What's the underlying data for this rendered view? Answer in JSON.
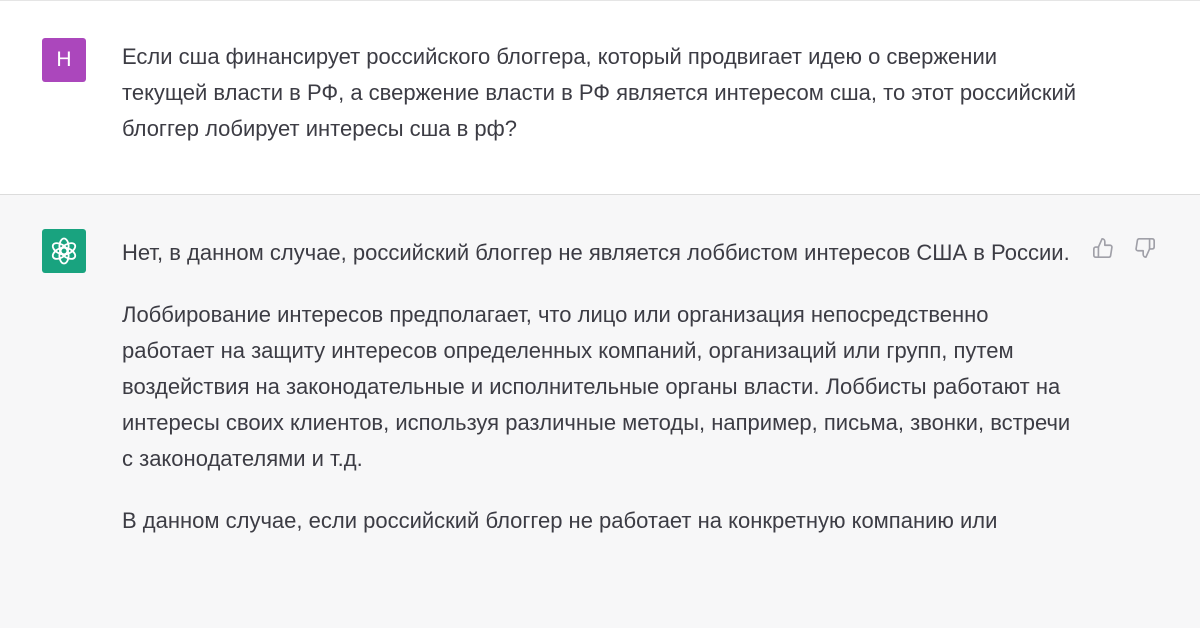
{
  "conversation": {
    "user_message": {
      "avatar_initial": "H",
      "avatar_color": "#ab47bc",
      "text": "Если сша финансирует российского блоггера, который продвигает идею о свержении текущей власти в РФ, а свержение власти в РФ является интересом сша, то этот российский блоггер лобирует интересы сша в рф?"
    },
    "assistant_message": {
      "avatar_icon": "openai-logo-icon",
      "avatar_color": "#19a37f",
      "paragraphs": [
        "Нет, в данном случае, российский блоггер не является лоббистом интересов США в России.",
        "Лоббирование интересов предполагает, что лицо или организация непосредственно работает на защиту интересов определенных компаний, организаций или групп, путем воздействия на законодательные и исполнительные органы власти. Лоббисты работают на интересы своих клиентов, используя различные методы, например, письма, звонки, встречи с законодателями и т.д.",
        "В данном случае, если российский блоггер не работает на конкретную компанию или"
      ],
      "feedback": {
        "thumbs_up_icon": "thumbs-up-icon",
        "thumbs_down_icon": "thumbs-down-icon"
      }
    }
  }
}
